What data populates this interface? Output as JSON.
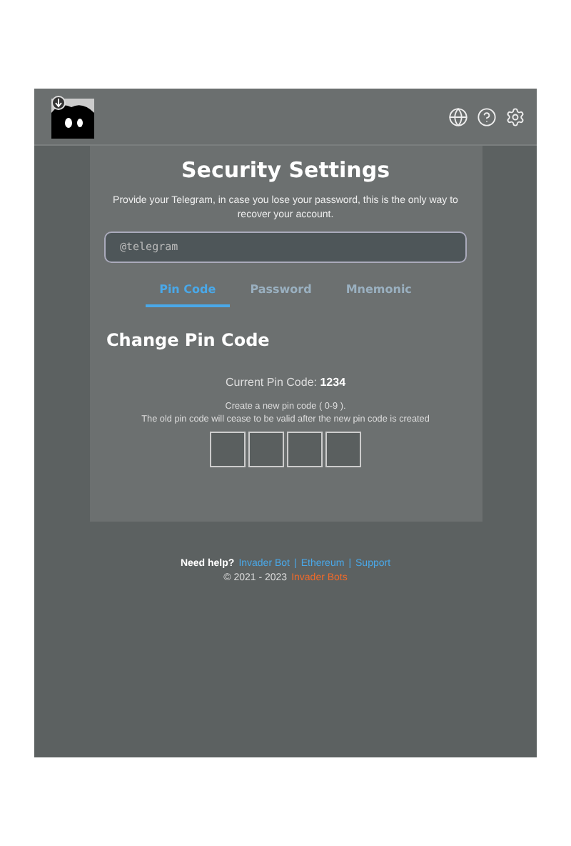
{
  "title": "Security Settings",
  "telegram": {
    "description": "Provide your Telegram, in case you lose your password, this is the only way to recover your account.",
    "placeholder": "@telegram"
  },
  "tabs": [
    {
      "label": "Pin Code",
      "selected": true
    },
    {
      "label": "Password",
      "selected": false
    },
    {
      "label": "Mnemonic",
      "selected": false
    }
  ],
  "section_title": "Change Pin Code",
  "current_pin": {
    "label": "Current Pin Code:",
    "value": "1234"
  },
  "instructions": [
    "Create a new pin code ( 0-9 ).",
    "The old pin code will cease to be valid after the new pin code is created"
  ],
  "footer": {
    "help_label": "Need help?",
    "links": [
      "Invader Bot",
      "Ethereum",
      "Support"
    ],
    "separator": "|",
    "copyright": "© 2021 - 2023",
    "brand": "Invader Bots"
  }
}
